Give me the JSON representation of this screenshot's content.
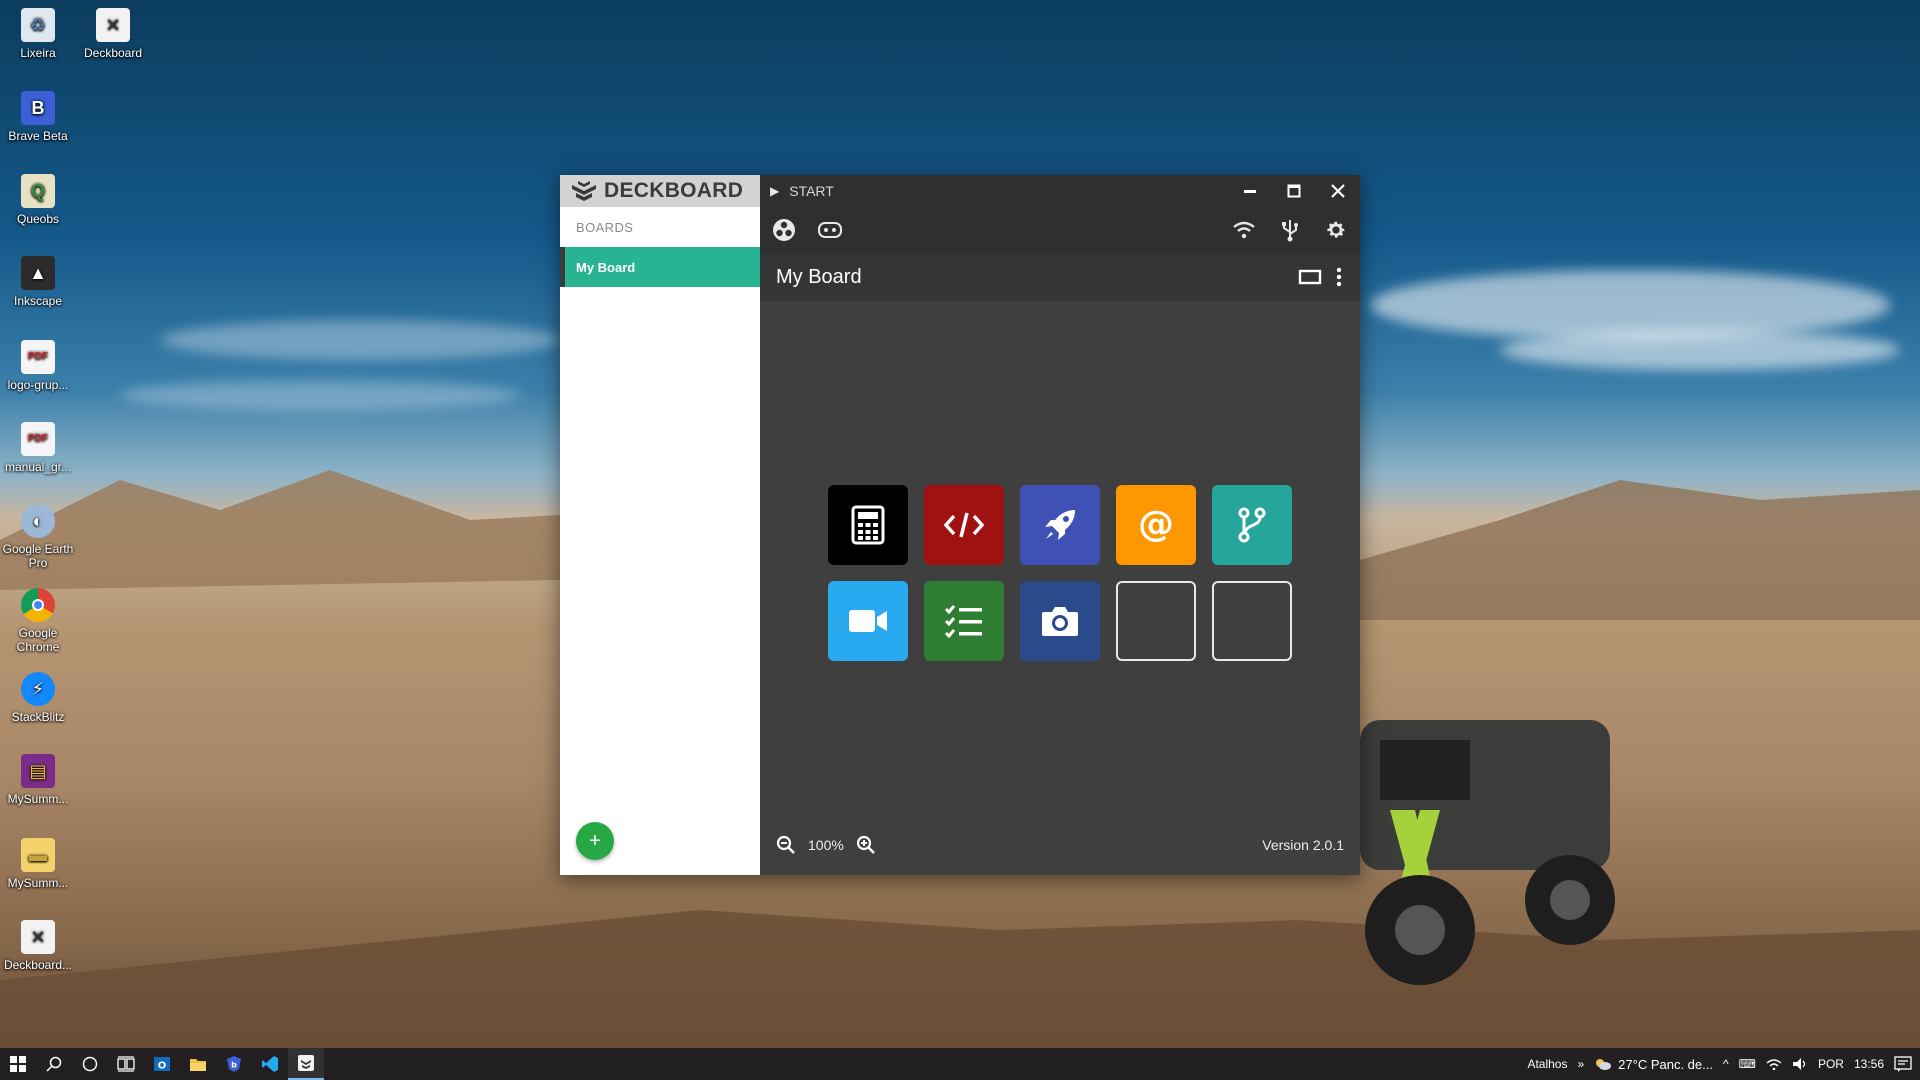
{
  "desktop": {
    "icons": [
      {
        "label": "Lixeira",
        "icon": "recycle-bin-icon"
      },
      {
        "label": "Deckboard",
        "icon": "deckboard-icon"
      },
      {
        "label": "Brave Beta",
        "icon": "brave-icon"
      },
      {
        "label": "Queobs",
        "icon": "queobs-icon"
      },
      {
        "label": "Inkscape",
        "icon": "inkscape-icon"
      },
      {
        "label": "logo-grup...",
        "icon": "pdf-icon"
      },
      {
        "label": "manual_gr...",
        "icon": "pdf-icon"
      },
      {
        "label": "Google Earth Pro",
        "icon": "google-earth-icon"
      },
      {
        "label": "Google Chrome",
        "icon": "chrome-icon"
      },
      {
        "label": "StackBlitz",
        "icon": "stackblitz-icon"
      },
      {
        "label": "MySumm...",
        "icon": "winrar-icon"
      },
      {
        "label": "MySumm...",
        "icon": "folder-icon"
      },
      {
        "label": "Deckboard...",
        "icon": "deckboard-icon"
      }
    ]
  },
  "app": {
    "brand": "DECKBOARD",
    "sidebar": {
      "section_label": "BOARDS",
      "items": [
        {
          "label": "My Board",
          "active": true
        }
      ],
      "add_label": "+"
    },
    "titlebar": {
      "label": "START"
    },
    "board": {
      "title": "My Board"
    },
    "buttons": [
      {
        "icon": "calculator-icon",
        "color": "#000000"
      },
      {
        "icon": "code-icon",
        "color": "#a01212"
      },
      {
        "icon": "rocket-icon",
        "color": "#3f51b5"
      },
      {
        "icon": "at-icon",
        "color": "#ff9800"
      },
      {
        "icon": "git-branch-icon",
        "color": "#26a69a"
      },
      {
        "icon": "video-camera-icon",
        "color": "#29a9ef"
      },
      {
        "icon": "checklist-icon",
        "color": "#2e7d32"
      },
      {
        "icon": "camera-icon",
        "color": "#2a4a8c"
      },
      {
        "icon": "empty-slot",
        "color": ""
      },
      {
        "icon": "empty-slot",
        "color": ""
      }
    ],
    "footer": {
      "zoom": "100%",
      "version": "Version 2.0.1"
    }
  },
  "taskbar": {
    "tray": {
      "shortcuts_label": "Atalhos",
      "weather": "27°C  Panc. de...",
      "lang": "POR",
      "time": "13:56"
    }
  }
}
